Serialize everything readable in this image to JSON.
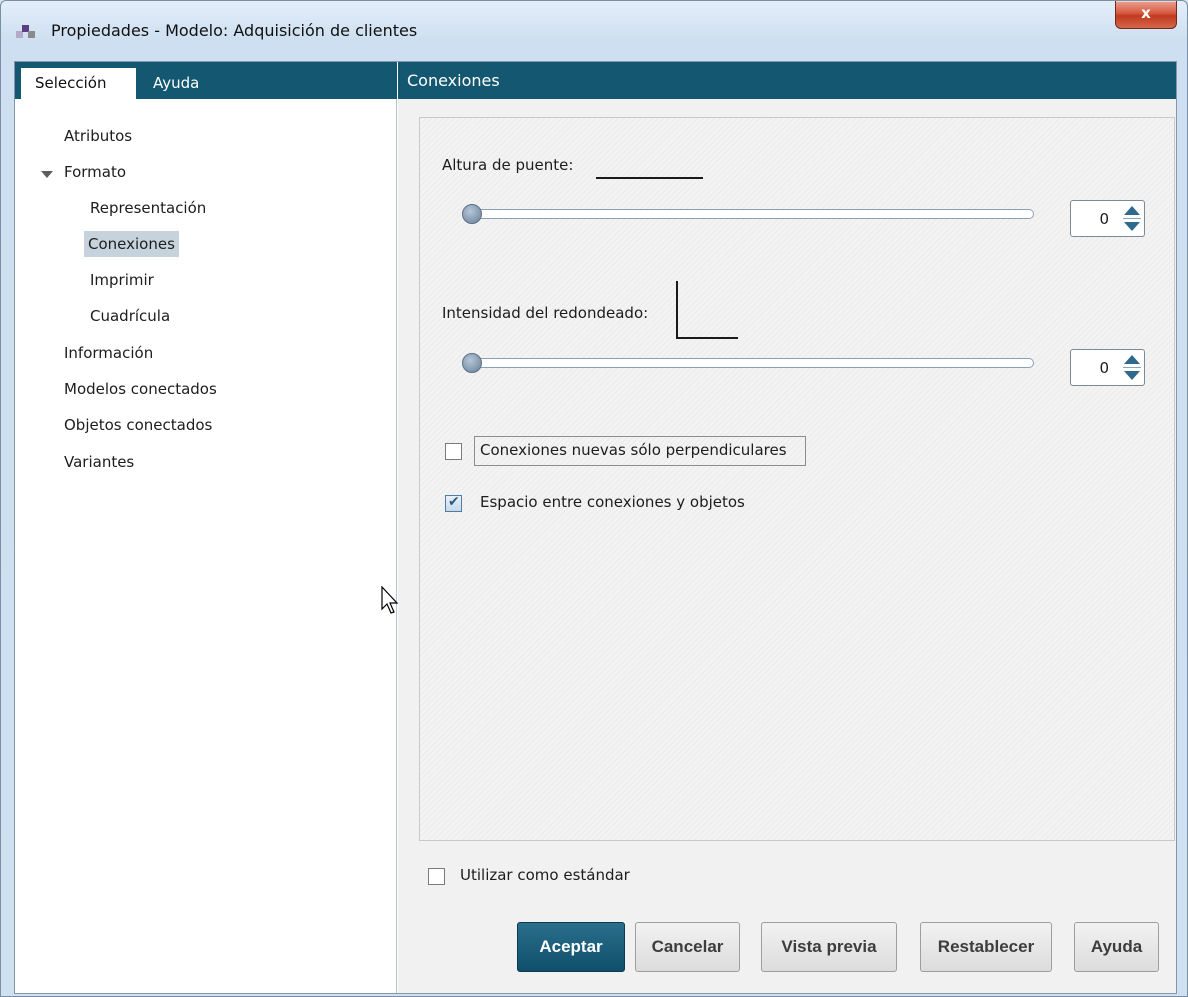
{
  "window": {
    "title": "Propiedades - Modelo: Adquisición de clientes",
    "close_label": "x"
  },
  "left_tabs": [
    {
      "label": "Selección",
      "active": true
    },
    {
      "label": "Ayuda",
      "active": false
    }
  ],
  "tree": [
    {
      "label": "Atributos",
      "level": 0
    },
    {
      "label": "Formato",
      "level": 0,
      "expanded": true
    },
    {
      "label": "Representación",
      "level": 1
    },
    {
      "label": "Conexiones",
      "level": 1,
      "selected": true
    },
    {
      "label": "Imprimir",
      "level": 1
    },
    {
      "label": "Cuadrícula",
      "level": 1
    },
    {
      "label": "Información",
      "level": 0
    },
    {
      "label": "Modelos conectados",
      "level": 0
    },
    {
      "label": "Objetos conectados",
      "level": 0
    },
    {
      "label": "Variantes",
      "level": 0
    }
  ],
  "panel": {
    "title": "Conexiones",
    "bridge_height": {
      "label": "Altura de puente:",
      "value": "0",
      "slider_level": 0
    },
    "rounding": {
      "label": "Intensidad del redondeado:",
      "value": "0",
      "slider_level": 0
    },
    "perpendicular_checkbox": {
      "label": "Conexiones nuevas sólo perpendiculares",
      "checked": false
    },
    "spacing_checkbox": {
      "label": "Espacio entre conexiones y objetos",
      "checked": true
    }
  },
  "standard_checkbox": {
    "label": "Utilizar como estándar",
    "checked": false
  },
  "buttons": {
    "accept": "Aceptar",
    "cancel": "Cancelar",
    "preview": "Vista previa",
    "reset": "Restablecer",
    "help": "Ayuda"
  },
  "colors": {
    "header": "#135770",
    "selected_row": "#c6d2dc",
    "primary_button": "#135770"
  }
}
